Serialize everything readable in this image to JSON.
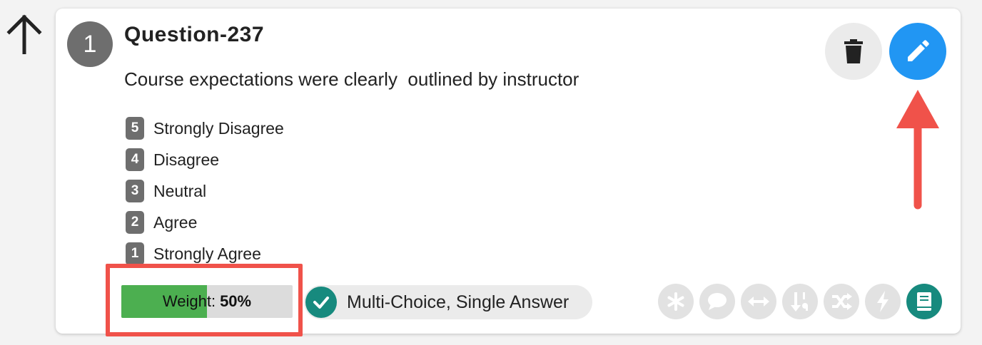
{
  "question": {
    "number": "1",
    "title": "Question-237",
    "text": "Course expectations were clearly  outlined by instructor",
    "answers": [
      {
        "value": "5",
        "label": "Strongly Disagree"
      },
      {
        "value": "4",
        "label": "Disagree"
      },
      {
        "value": "3",
        "label": "Neutral"
      },
      {
        "value": "2",
        "label": "Agree"
      },
      {
        "value": "1",
        "label": "Strongly Agree"
      }
    ]
  },
  "weight": {
    "label": "Weight:",
    "value": "50%",
    "fraction": 0.5
  },
  "type": {
    "label": "Multi-Choice, Single Answer",
    "icon": "check-circle-icon"
  },
  "actions": {
    "delete_icon": "trash-icon",
    "edit_icon": "pencil-icon"
  },
  "option_icons": [
    "asterisk-icon",
    "comment-icon",
    "arrows-horizontal-icon",
    "sort-numeric-icon",
    "shuffle-icon",
    "lightning-icon",
    "book-icon"
  ],
  "colors": {
    "edit_button": "#2196f3",
    "weight_fill": "#4caf50",
    "accent_teal": "#178a7e",
    "highlight_red": "#f0524a",
    "badge_gray": "#6e6e6e"
  }
}
